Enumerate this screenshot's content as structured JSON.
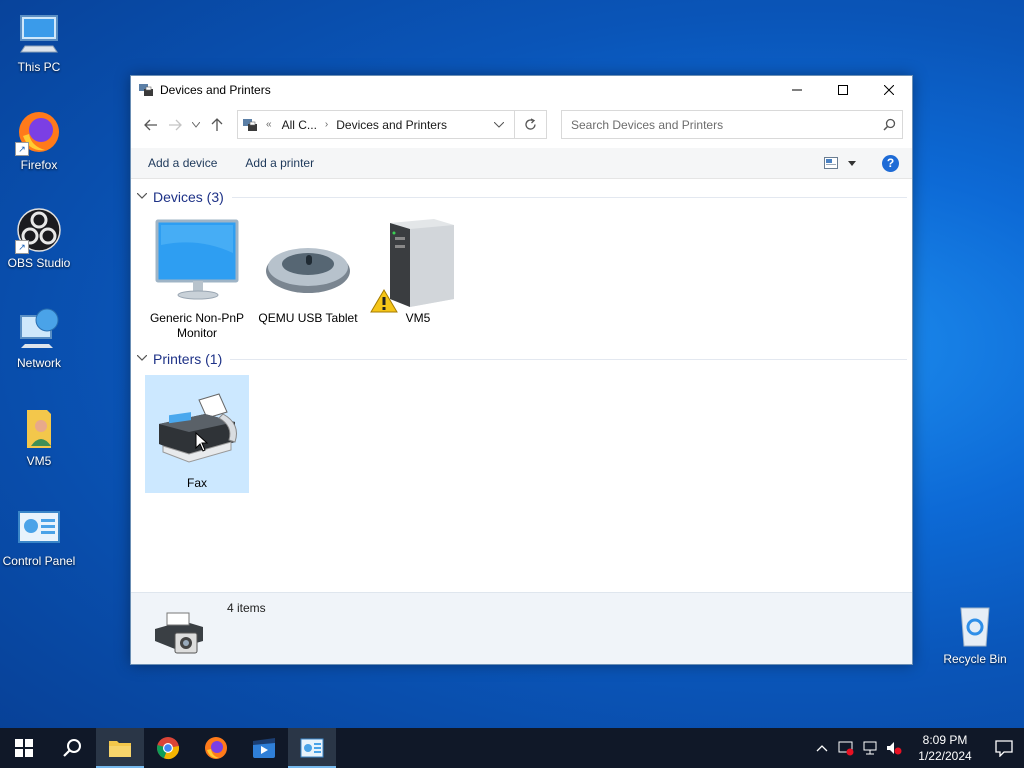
{
  "desktop": {
    "icons": [
      {
        "label": "This PC"
      },
      {
        "label": "Firefox"
      },
      {
        "label": "OBS Studio"
      },
      {
        "label": "Network"
      },
      {
        "label": "VM5"
      },
      {
        "label": "Control Panel"
      },
      {
        "label": "Recycle Bin"
      }
    ]
  },
  "window": {
    "title": "Devices and Printers",
    "address": {
      "root": "All C...",
      "current": "Devices and Printers"
    },
    "search_placeholder": "Search Devices and Printers",
    "commands": {
      "add_device": "Add a device",
      "add_printer": "Add a printer"
    },
    "groups": [
      {
        "header": "Devices (3)",
        "items": [
          {
            "label": "Generic Non-PnP Monitor",
            "icon": "monitor-icon"
          },
          {
            "label": "QEMU USB Tablet",
            "icon": "mouse-icon"
          },
          {
            "label": "VM5",
            "icon": "computer-tower-icon",
            "warning": true
          }
        ]
      },
      {
        "header": "Printers (1)",
        "items": [
          {
            "label": "Fax",
            "icon": "fax-icon",
            "selected": true
          }
        ]
      }
    ],
    "details": {
      "count": "4 items"
    }
  },
  "taskbar": {
    "clock_time": "8:09 PM",
    "clock_date": "1/22/2024"
  },
  "colors": {
    "accent": "#1e6bd6",
    "selection": "#cce8ff",
    "group_header": "#1e3287"
  }
}
